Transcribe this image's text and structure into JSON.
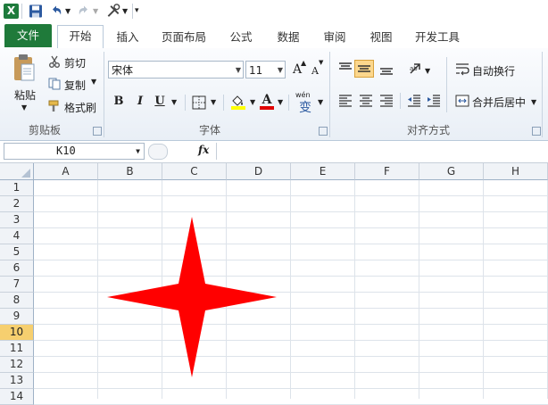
{
  "app": {
    "icon_letter": "X"
  },
  "tabs": {
    "file": "文件",
    "home": "开始",
    "insert": "插入",
    "page_layout": "页面布局",
    "formulas": "公式",
    "data": "数据",
    "review": "审阅",
    "view": "视图",
    "developer": "开发工具"
  },
  "clipboard": {
    "paste": "粘贴",
    "cut": "剪切",
    "copy": "复制",
    "format_painter": "格式刷",
    "group_label": "剪贴板"
  },
  "font": {
    "name": "宋体",
    "size": "11",
    "bold": "B",
    "italic": "I",
    "underline": "U",
    "grow": "A",
    "shrink": "A",
    "font_color_letter": "A",
    "phonetic": "wén",
    "phonetic_char": "变",
    "group_label": "字体"
  },
  "alignment": {
    "wrap_text": "自动换行",
    "merge_center": "合并后居中",
    "group_label": "对齐方式"
  },
  "formula_bar": {
    "name_box": "K10",
    "fx": "fx"
  },
  "grid": {
    "columns": [
      "A",
      "B",
      "C",
      "D",
      "E",
      "F",
      "G",
      "H"
    ],
    "rows": [
      "1",
      "2",
      "3",
      "4",
      "5",
      "6",
      "7",
      "8",
      "9",
      "10",
      "11",
      "12",
      "13",
      "14"
    ],
    "selected_row": "10"
  },
  "colors": {
    "file_tab": "#1f7a3a",
    "star": "#ff0000",
    "selected_row": "#f6cf6f",
    "font_color_bar": "#e00000",
    "fill_color_bar": "#ffff00"
  }
}
